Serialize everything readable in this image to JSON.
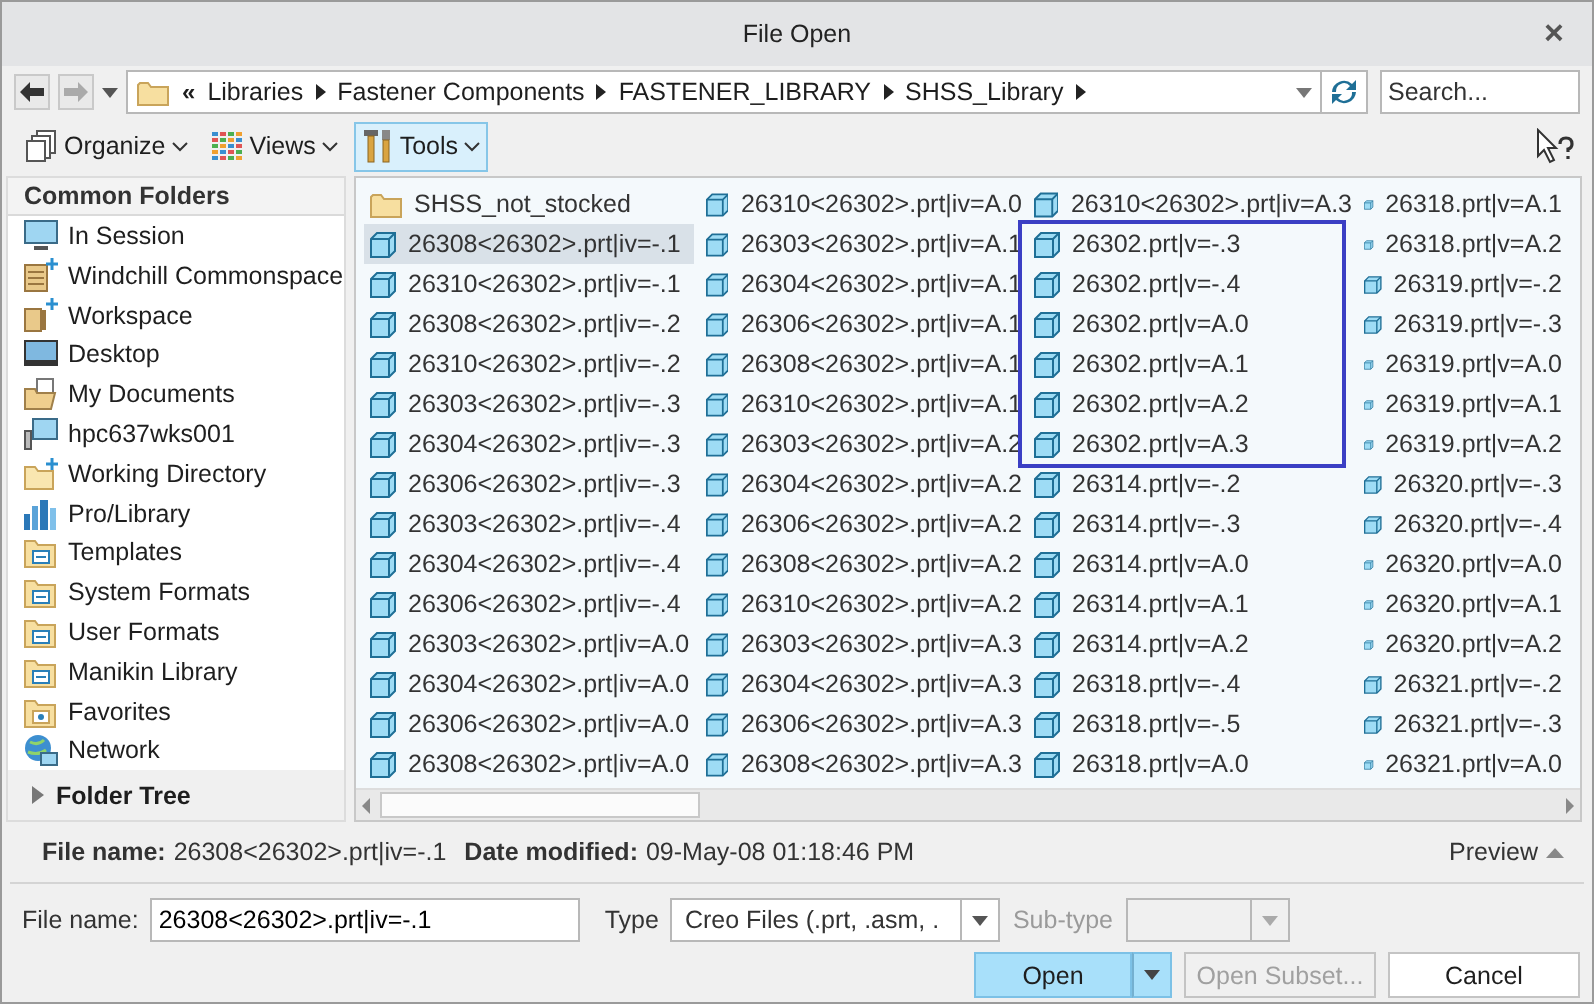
{
  "window": {
    "title": "File Open",
    "close": "×"
  },
  "address_bar": {
    "overflow_mark": "«",
    "path": [
      "Libraries",
      "Fastener Components",
      "FASTENER_LIBRARY",
      "SHSS_Library"
    ],
    "search_placeholder": "Search..."
  },
  "toolbar": [
    {
      "label": "Organize",
      "kind": "organize",
      "highlighted": false
    },
    {
      "label": "Views",
      "kind": "views",
      "highlighted": false
    },
    {
      "label": "Tools",
      "kind": "tools",
      "highlighted": true
    }
  ],
  "sidebar": {
    "title": "Common Folders",
    "items": [
      {
        "label": "In Session",
        "kind": "monitor"
      },
      {
        "label": "Windchill Commonspace",
        "kind": "cabinet"
      },
      {
        "label": "Workspace",
        "kind": "workspace"
      },
      {
        "label": "Desktop",
        "kind": "desktop"
      },
      {
        "label": "My Documents",
        "kind": "documents"
      },
      {
        "label": "hpc637wks001",
        "kind": "computer"
      },
      {
        "label": "Working Directory",
        "kind": "folder-star"
      },
      {
        "label": "Pro/Library",
        "kind": "library"
      },
      {
        "label": "Templates",
        "kind": "template-folder"
      },
      {
        "label": "System Formats",
        "kind": "template-folder"
      },
      {
        "label": "User Formats",
        "kind": "template-folder"
      },
      {
        "label": "Manikin Library",
        "kind": "template-folder"
      },
      {
        "label": "Favorites",
        "kind": "favorites-folder"
      }
    ],
    "network": {
      "label": "Network",
      "kind": "network"
    },
    "folder_tree": "Folder Tree"
  },
  "files": {
    "columns": [
      {
        "items": [
          {
            "name": "SHSS_not_stocked",
            "kind": "folder",
            "selected": false,
            "outlined": false
          },
          {
            "name": "26308<26302>.prt|iv=-.1",
            "kind": "part",
            "selected": true,
            "outlined": false
          },
          {
            "name": "26310<26302>.prt|iv=-.1",
            "kind": "part",
            "selected": false,
            "outlined": false
          },
          {
            "name": "26308<26302>.prt|iv=-.2",
            "kind": "part",
            "selected": false,
            "outlined": false
          },
          {
            "name": "26310<26302>.prt|iv=-.2",
            "kind": "part",
            "selected": false,
            "outlined": false
          },
          {
            "name": "26303<26302>.prt|iv=-.3",
            "kind": "part",
            "selected": false,
            "outlined": false
          },
          {
            "name": "26304<26302>.prt|iv=-.3",
            "kind": "part",
            "selected": false,
            "outlined": false
          },
          {
            "name": "26306<26302>.prt|iv=-.3",
            "kind": "part",
            "selected": false,
            "outlined": false
          },
          {
            "name": "26303<26302>.prt|iv=-.4",
            "kind": "part",
            "selected": false,
            "outlined": false
          },
          {
            "name": "26304<26302>.prt|iv=-.4",
            "kind": "part",
            "selected": false,
            "outlined": false
          },
          {
            "name": "26306<26302>.prt|iv=-.4",
            "kind": "part",
            "selected": false,
            "outlined": false
          },
          {
            "name": "26303<26302>.prt|iv=A.0",
            "kind": "part",
            "selected": false,
            "outlined": false
          },
          {
            "name": "26304<26302>.prt|iv=A.0",
            "kind": "part",
            "selected": false,
            "outlined": false
          },
          {
            "name": "26306<26302>.prt|iv=A.0",
            "kind": "part",
            "selected": false,
            "outlined": false
          },
          {
            "name": "26308<26302>.prt|iv=A.0",
            "kind": "part",
            "selected": false,
            "outlined": false
          }
        ]
      },
      {
        "items": [
          {
            "name": "26310<26302>.prt|iv=A.0",
            "kind": "part",
            "selected": false,
            "outlined": false
          },
          {
            "name": "26303<26302>.prt|iv=A.1",
            "kind": "part",
            "selected": false,
            "outlined": false
          },
          {
            "name": "26304<26302>.prt|iv=A.1",
            "kind": "part",
            "selected": false,
            "outlined": false
          },
          {
            "name": "26306<26302>.prt|iv=A.1",
            "kind": "part",
            "selected": false,
            "outlined": false
          },
          {
            "name": "26308<26302>.prt|iv=A.1",
            "kind": "part",
            "selected": false,
            "outlined": false
          },
          {
            "name": "26310<26302>.prt|iv=A.1",
            "kind": "part",
            "selected": false,
            "outlined": false
          },
          {
            "name": "26303<26302>.prt|iv=A.2",
            "kind": "part",
            "selected": false,
            "outlined": false
          },
          {
            "name": "26304<26302>.prt|iv=A.2",
            "kind": "part",
            "selected": false,
            "outlined": false
          },
          {
            "name": "26306<26302>.prt|iv=A.2",
            "kind": "part",
            "selected": false,
            "outlined": false
          },
          {
            "name": "26308<26302>.prt|iv=A.2",
            "kind": "part",
            "selected": false,
            "outlined": false
          },
          {
            "name": "26310<26302>.prt|iv=A.2",
            "kind": "part",
            "selected": false,
            "outlined": false
          },
          {
            "name": "26303<26302>.prt|iv=A.3",
            "kind": "part",
            "selected": false,
            "outlined": false
          },
          {
            "name": "26304<26302>.prt|iv=A.3",
            "kind": "part",
            "selected": false,
            "outlined": false
          },
          {
            "name": "26306<26302>.prt|iv=A.3",
            "kind": "part",
            "selected": false,
            "outlined": false
          },
          {
            "name": "26308<26302>.prt|iv=A.3",
            "kind": "part",
            "selected": false,
            "outlined": false
          }
        ]
      },
      {
        "items": [
          {
            "name": "26310<26302>.prt|iv=A.3",
            "kind": "part",
            "selected": false,
            "outlined": false
          },
          {
            "name": "26302.prt|v=-.3",
            "kind": "part",
            "selected": false,
            "outlined": true
          },
          {
            "name": "26302.prt|v=-.4",
            "kind": "part",
            "selected": false,
            "outlined": true
          },
          {
            "name": "26302.prt|v=A.0",
            "kind": "part",
            "selected": false,
            "outlined": true
          },
          {
            "name": "26302.prt|v=A.1",
            "kind": "part",
            "selected": false,
            "outlined": true
          },
          {
            "name": "26302.prt|v=A.2",
            "kind": "part",
            "selected": false,
            "outlined": true
          },
          {
            "name": "26302.prt|v=A.3",
            "kind": "part",
            "selected": false,
            "outlined": true
          },
          {
            "name": "26314.prt|v=-.2",
            "kind": "part",
            "selected": false,
            "outlined": false
          },
          {
            "name": "26314.prt|v=-.3",
            "kind": "part",
            "selected": false,
            "outlined": false
          },
          {
            "name": "26314.prt|v=A.0",
            "kind": "part",
            "selected": false,
            "outlined": false
          },
          {
            "name": "26314.prt|v=A.1",
            "kind": "part",
            "selected": false,
            "outlined": false
          },
          {
            "name": "26314.prt|v=A.2",
            "kind": "part",
            "selected": false,
            "outlined": false
          },
          {
            "name": "26318.prt|v=-.4",
            "kind": "part",
            "selected": false,
            "outlined": false
          },
          {
            "name": "26318.prt|v=-.5",
            "kind": "part",
            "selected": false,
            "outlined": false
          },
          {
            "name": "26318.prt|v=A.0",
            "kind": "part",
            "selected": false,
            "outlined": false
          }
        ]
      },
      {
        "items": [
          {
            "name": "26318.prt|v=A.1",
            "kind": "part",
            "selected": false,
            "outlined": false
          },
          {
            "name": "26318.prt|v=A.2",
            "kind": "part",
            "selected": false,
            "outlined": false
          },
          {
            "name": "26319.prt|v=-.2",
            "kind": "part",
            "selected": false,
            "outlined": false
          },
          {
            "name": "26319.prt|v=-.3",
            "kind": "part",
            "selected": false,
            "outlined": false
          },
          {
            "name": "26319.prt|v=A.0",
            "kind": "part",
            "selected": false,
            "outlined": false
          },
          {
            "name": "26319.prt|v=A.1",
            "kind": "part",
            "selected": false,
            "outlined": false
          },
          {
            "name": "26319.prt|v=A.2",
            "kind": "part",
            "selected": false,
            "outlined": false
          },
          {
            "name": "26320.prt|v=-.3",
            "kind": "part",
            "selected": false,
            "outlined": false
          },
          {
            "name": "26320.prt|v=-.4",
            "kind": "part",
            "selected": false,
            "outlined": false
          },
          {
            "name": "26320.prt|v=A.0",
            "kind": "part",
            "selected": false,
            "outlined": false
          },
          {
            "name": "26320.prt|v=A.1",
            "kind": "part",
            "selected": false,
            "outlined": false
          },
          {
            "name": "26320.prt|v=A.2",
            "kind": "part",
            "selected": false,
            "outlined": false
          },
          {
            "name": "26321.prt|v=-.2",
            "kind": "part",
            "selected": false,
            "outlined": false
          },
          {
            "name": "26321.prt|v=-.3",
            "kind": "part",
            "selected": false,
            "outlined": false
          },
          {
            "name": "26321.prt|v=A.0",
            "kind": "part",
            "selected": false,
            "outlined": false
          }
        ]
      }
    ]
  },
  "info": {
    "file_name_label": "File name:",
    "file_name": "26308<26302>.prt|iv=-.1",
    "date_label": "Date modified:",
    "date": "09-May-08 01:18:46 PM",
    "preview": "Preview"
  },
  "form": {
    "file_name_label": "File name:",
    "file_name_value": "26308<26302>.prt|iv=-.1",
    "type_label": "Type",
    "type_value": "Creo Files (.prt, .asm, .",
    "subtype_label": "Sub-type",
    "subtype_disabled": true
  },
  "buttons": [
    {
      "label": "Open",
      "kind": "primary",
      "disabled": false
    },
    {
      "label": "Open Subset...",
      "kind": "normal",
      "disabled": true
    },
    {
      "label": "Cancel",
      "kind": "normal",
      "disabled": false
    }
  ]
}
